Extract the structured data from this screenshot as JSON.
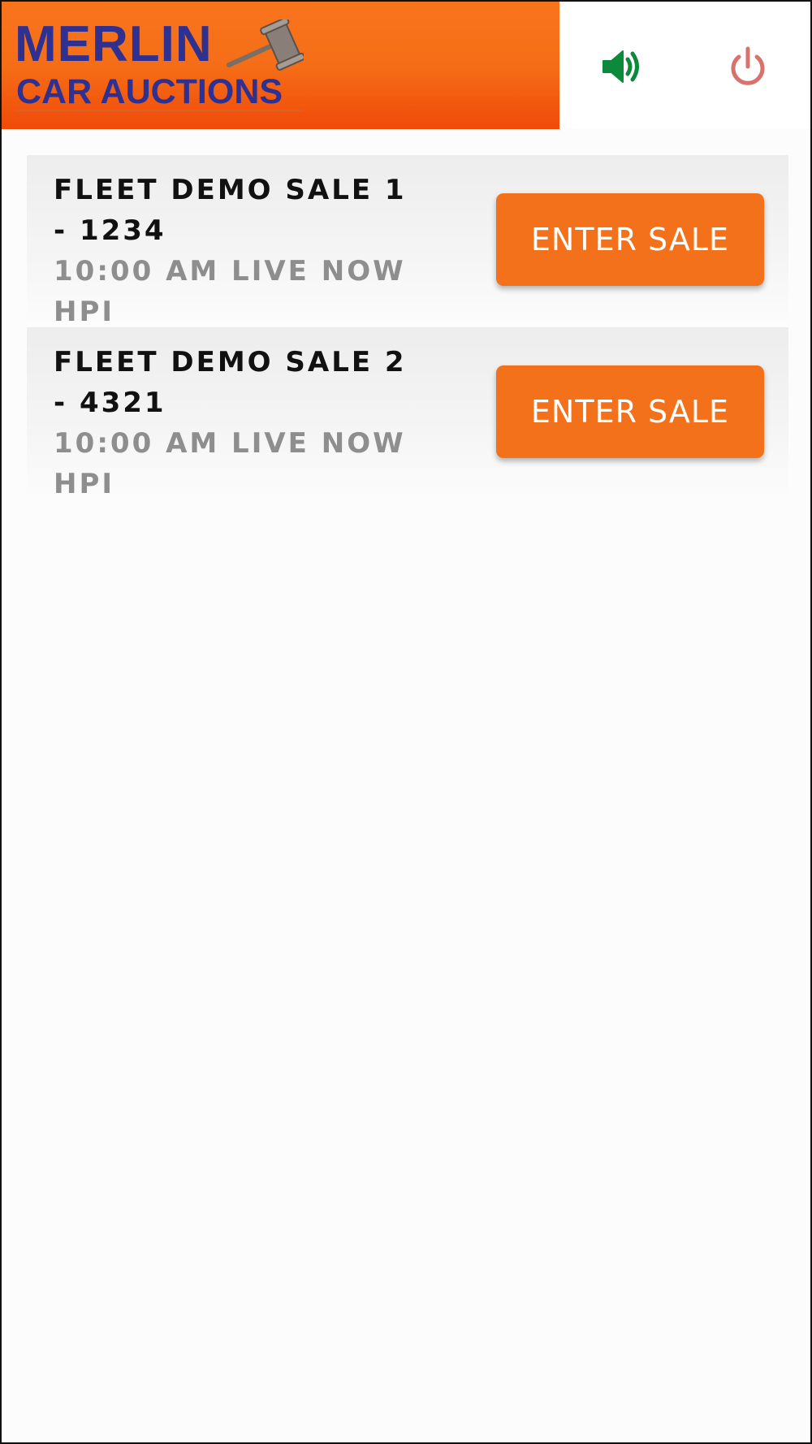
{
  "brand": {
    "line1": "MERLIN",
    "line2": "CAR AUCTIONS",
    "colors": {
      "header_orange": "#f56e17",
      "logo_blue": "#2e3192",
      "button_orange": "#f4711c"
    }
  },
  "header": {
    "sound_icon": "speaker-volume-icon",
    "sound_color": "#0a8a3a",
    "power_icon": "power-icon",
    "power_color": "#d9716f"
  },
  "sales": [
    {
      "name": "FLEET DEMO SALE 1 - 1234",
      "status": "10:00 AM LIVE NOW HPI",
      "button_label": "ENTER SALE"
    },
    {
      "name": "FLEET DEMO SALE 2 - 4321",
      "status": "10:00 AM LIVE NOW HPI",
      "button_label": "ENTER SALE"
    }
  ]
}
